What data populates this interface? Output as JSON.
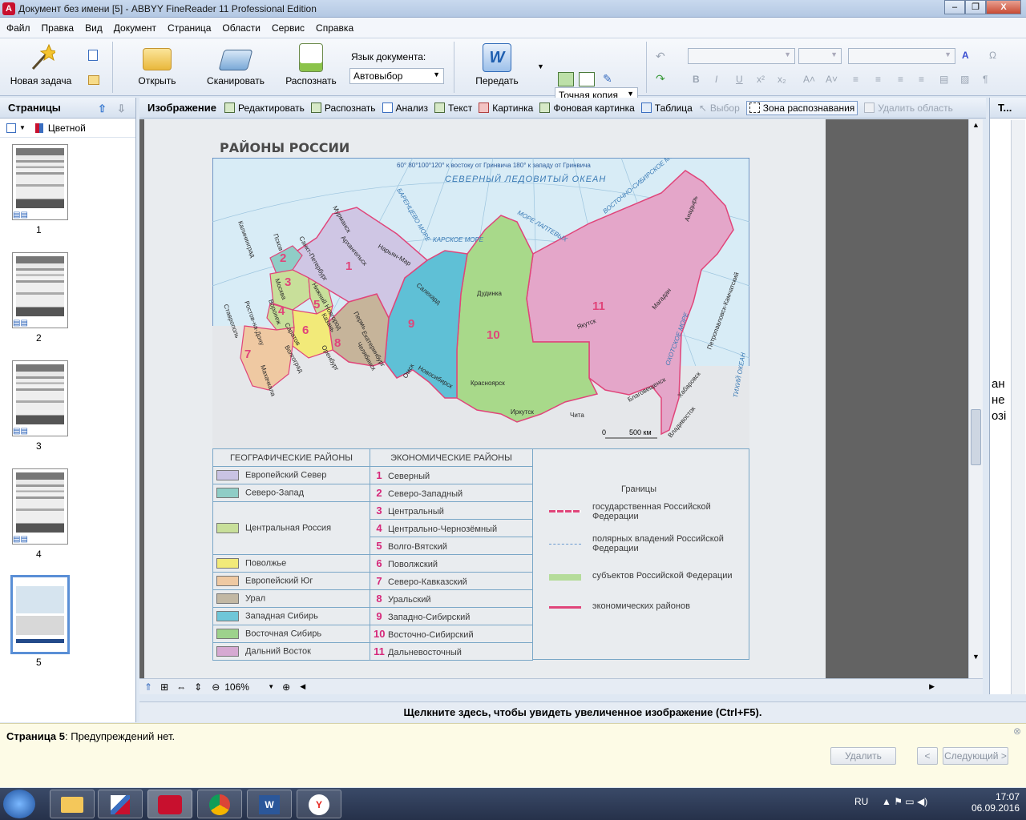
{
  "window": {
    "title": "Документ без имени [5] - ABBYY FineReader 11 Professional Edition",
    "buttons": [
      "–",
      "❐",
      "X"
    ]
  },
  "menu": [
    "Файл",
    "Правка",
    "Вид",
    "Документ",
    "Страница",
    "Области",
    "Сервис",
    "Справка"
  ],
  "toolbar": {
    "new_task": "Новая задача",
    "open": "Открыть",
    "scan": "Сканировать",
    "recognize": "Распознать",
    "lang_label": "Язык документа:",
    "lang_value": "Автовыбор",
    "send": "Передать",
    "mode_value": "Точная копия",
    "format_buttons": [
      "B",
      "I",
      "U",
      "x²",
      "x₂",
      "A˄",
      "A˅"
    ]
  },
  "pages_panel": {
    "title": "Страницы",
    "color_mode": "Цветной",
    "pages": [
      "1",
      "2",
      "3",
      "4",
      "5"
    ],
    "selected": "5"
  },
  "image_panel": {
    "title": "Изображение",
    "tools": [
      {
        "label": "Редактировать",
        "enabled": true
      },
      {
        "label": "Распознать",
        "enabled": true
      },
      {
        "label": "Анализ",
        "enabled": true
      },
      {
        "label": "Текст",
        "enabled": true
      },
      {
        "label": "Картинка",
        "enabled": true
      },
      {
        "label": "Фоновая картинка",
        "enabled": true
      },
      {
        "label": "Таблица",
        "enabled": true
      },
      {
        "label": "Выбор",
        "enabled": false
      },
      {
        "label": "Зона распознавания",
        "enabled": true,
        "active": true
      },
      {
        "label": "Удалить область",
        "enabled": false
      }
    ],
    "zoom": "106%"
  },
  "right_panel": {
    "title": "Т...",
    "partial_text": [
      "ан",
      "не",
      "озі"
    ]
  },
  "map": {
    "heading": "РАЙОНЫ РОССИИ",
    "ocean": "СЕВЕРНЫЙ  ЛЕДОВИТЫЙ  ОКЕАН",
    "meridians": "60°  80°100°120° к востоку от Гринвича 180° к западу от Гринвича",
    "scale": "500 км",
    "scale_zero": "0",
    "cities": [
      "Москва",
      "Санкт-Петербург",
      "Архангельск",
      "Мурманск",
      "Нарьян-Мар",
      "Салехард",
      "Дудинка",
      "Якутск",
      "Магадан",
      "Анадырь",
      "Петропавловск-Камчатский",
      "Хабаровск",
      "Благовещенск",
      "Владивосток",
      "Чита",
      "Иркутск",
      "Красноярск",
      "Новосибирск",
      "Омск",
      "Екатеринбург",
      "Челябинск",
      "Пермь",
      "Оренбург",
      "Казань",
      "Саратов",
      "Волгоград",
      "Воронеж",
      "Ростов-на-Дону",
      "Махачкала",
      "Калининград",
      "Ставрополь",
      "Нижний Новгород",
      "Псков"
    ],
    "seas": [
      "КАРСКОЕ МОРЕ",
      "МОРЕ ЛАПТЕВЫХ",
      "ВОСТОЧНО-СИБИРСКОЕ МОРЕ",
      "БАРЕНЦЕВО МОРЕ",
      "ОХОТСКОЕ МОРЕ",
      "ТИХИЙ ОКЕАН"
    ],
    "region_numbers": [
      "1",
      "2",
      "3",
      "4",
      "5",
      "6",
      "7",
      "8",
      "9",
      "10",
      "11"
    ]
  },
  "legend": {
    "geo_header": "ГЕОГРАФИЧЕСКИЕ РАЙОНЫ",
    "econ_header": "ЭКОНОМИЧЕСКИЕ РАЙОНЫ",
    "geo": [
      {
        "name": "Европейский Север",
        "color": "#c9c3e3"
      },
      {
        "name": "Северо-Запад",
        "color": "#8fcdc6"
      },
      {
        "name": "Центральная Россия",
        "color": "#c8df9a"
      },
      {
        "name": "Поволжье",
        "color": "#f2ea79"
      },
      {
        "name": "Европейский Юг",
        "color": "#efc9a2"
      },
      {
        "name": "Урал",
        "color": "#c2b8a4"
      },
      {
        "name": "Западная Сибирь",
        "color": "#6fc6d8"
      },
      {
        "name": "Восточная Сибирь",
        "color": "#9dd28c"
      },
      {
        "name": "Дальний Восток",
        "color": "#d6a9d2"
      }
    ],
    "econ": [
      {
        "n": "1",
        "name": "Северный"
      },
      {
        "n": "2",
        "name": "Северо-Западный"
      },
      {
        "n": "3",
        "name": "Центральный"
      },
      {
        "n": "4",
        "name": "Центрально-Чернозёмный"
      },
      {
        "n": "5",
        "name": "Волго-Вятский"
      },
      {
        "n": "6",
        "name": "Поволжский"
      },
      {
        "n": "7",
        "name": "Северо-Кавказский"
      },
      {
        "n": "8",
        "name": "Уральский"
      },
      {
        "n": "9",
        "name": "Западно-Сибирский"
      },
      {
        "n": "10",
        "name": "Восточно-Сибирский"
      },
      {
        "n": "11",
        "name": "Дальневосточный"
      }
    ],
    "borders_title": "Границы",
    "borders": [
      "государственная Российской Федерации",
      "полярных владений Российской Федерации",
      "субъектов Российской Федерации",
      "экономических районов"
    ]
  },
  "hint": "Щелкните здесь, чтобы увидеть увеличенное изображение (Ctrl+F5).",
  "warning": {
    "page_label": "Страница 5",
    "text": ": Предупреждений нет.",
    "delete": "Удалить",
    "prev": "<",
    "next": "Следующий >"
  },
  "taskbar": {
    "lang": "RU",
    "time": "17:07",
    "date": "06.09.2016"
  },
  "colors": {
    "dalniy": "#e4a6c9",
    "vost_sib": "#a8d98a",
    "zap_sib": "#5fc0d6",
    "ural": "#c6b49a",
    "sever": "#cfc6e4",
    "sea": "#d8ecf6"
  }
}
